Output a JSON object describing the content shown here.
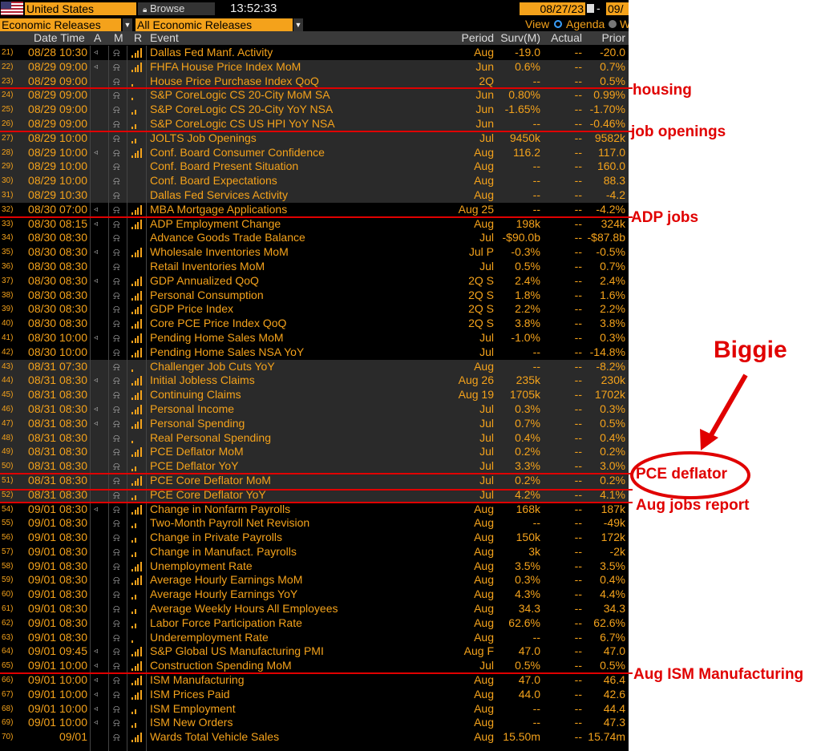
{
  "toolbar": {
    "country": "United States",
    "browse": "Browse",
    "time": "13:52:33",
    "start_date": "08/27/23",
    "end_date_partial": "09/",
    "dash": "-",
    "releases_dropdown_1": "Economic Releases",
    "releases_dropdown_2": "All Economic Releases",
    "view_label": "View",
    "view_agenda": "Agenda",
    "view_other_partial": "W"
  },
  "columns": {
    "datetime": "Date Time",
    "a": "A",
    "m": "M",
    "r": "R",
    "event": "Event",
    "period": "Period",
    "surv": "Surv(M)",
    "actual": "Actual",
    "prior": "Prior"
  },
  "rows": [
    {
      "n": "21)",
      "dt": "08/28 10:30",
      "spk": true,
      "rel": 4,
      "ev": "Dallas Fed Manf. Activity",
      "per": "Aug",
      "surv": "-19.0",
      "act": "--",
      "pri": "-20.0",
      "shade": false
    },
    {
      "n": "22)",
      "dt": "08/29 09:00",
      "spk": true,
      "rel": 4,
      "ev": "FHFA House Price Index MoM",
      "per": "Jun",
      "surv": "0.6%",
      "act": "--",
      "pri": "0.7%",
      "shade": true
    },
    {
      "n": "23)",
      "dt": "08/29 09:00",
      "spk": false,
      "rel": 1,
      "ev": "House Price Purchase Index QoQ",
      "per": "2Q",
      "surv": "--",
      "act": "--",
      "pri": "0.5%",
      "shade": true
    },
    {
      "n": "24)",
      "dt": "08/29 09:00",
      "spk": false,
      "rel": 1,
      "ev": "S&P CoreLogic CS 20-City MoM SA",
      "per": "Jun",
      "surv": "0.80%",
      "act": "--",
      "pri": "0.99%",
      "shade": true
    },
    {
      "n": "25)",
      "dt": "08/29 09:00",
      "spk": false,
      "rel": 2,
      "ev": "S&P CoreLogic CS 20-City YoY NSA",
      "per": "Jun",
      "surv": "-1.65%",
      "act": "--",
      "pri": "-1.70%",
      "shade": true
    },
    {
      "n": "26)",
      "dt": "08/29 09:00",
      "spk": false,
      "rel": 2,
      "ev": "S&P CoreLogic CS US HPI YoY NSA",
      "per": "Jun",
      "surv": "--",
      "act": "--",
      "pri": "-0.46%",
      "shade": true
    },
    {
      "n": "27)",
      "dt": "08/29 10:00",
      "spk": false,
      "rel": 2,
      "ev": "JOLTS Job Openings",
      "per": "Jul",
      "surv": "9450k",
      "act": "--",
      "pri": "9582k",
      "shade": true
    },
    {
      "n": "28)",
      "dt": "08/29 10:00",
      "spk": true,
      "rel": 4,
      "ev": "Conf. Board Consumer Confidence",
      "per": "Aug",
      "surv": "116.2",
      "act": "--",
      "pri": "117.0",
      "shade": true
    },
    {
      "n": "29)",
      "dt": "08/29 10:00",
      "spk": false,
      "rel": 0,
      "ev": "Conf. Board Present Situation",
      "per": "Aug",
      "surv": "--",
      "act": "--",
      "pri": "160.0",
      "shade": true
    },
    {
      "n": "30)",
      "dt": "08/29 10:00",
      "spk": false,
      "rel": 0,
      "ev": "Conf. Board Expectations",
      "per": "Aug",
      "surv": "--",
      "act": "--",
      "pri": "88.3",
      "shade": true
    },
    {
      "n": "31)",
      "dt": "08/29 10:30",
      "spk": false,
      "rel": 0,
      "ev": "Dallas Fed Services Activity",
      "per": "Aug",
      "surv": "--",
      "act": "--",
      "pri": "-4.2",
      "shade": true
    },
    {
      "n": "32)",
      "dt": "08/30 07:00",
      "spk": true,
      "rel": 4,
      "ev": "MBA Mortgage Applications",
      "per": "Aug 25",
      "surv": "--",
      "act": "--",
      "pri": "-4.2%",
      "shade": false
    },
    {
      "n": "33)",
      "dt": "08/30 08:15",
      "spk": true,
      "rel": 4,
      "ev": "ADP Employment Change",
      "per": "Aug",
      "surv": "198k",
      "act": "--",
      "pri": "324k",
      "shade": false
    },
    {
      "n": "34)",
      "dt": "08/30 08:30",
      "spk": false,
      "rel": 0,
      "ev": "Advance Goods Trade Balance",
      "per": "Jul",
      "surv": "-$90.0b",
      "act": "--",
      "pri": "-$87.8b",
      "shade": false
    },
    {
      "n": "35)",
      "dt": "08/30 08:30",
      "spk": true,
      "rel": 4,
      "ev": "Wholesale Inventories MoM",
      "per": "Jul P",
      "surv": "-0.3%",
      "act": "--",
      "pri": "-0.5%",
      "shade": false
    },
    {
      "n": "36)",
      "dt": "08/30 08:30",
      "spk": false,
      "rel": 0,
      "ev": "Retail Inventories MoM",
      "per": "Jul",
      "surv": "0.5%",
      "act": "--",
      "pri": "0.7%",
      "shade": false
    },
    {
      "n": "37)",
      "dt": "08/30 08:30",
      "spk": true,
      "rel": 4,
      "ev": "GDP Annualized QoQ",
      "per": "2Q S",
      "surv": "2.4%",
      "act": "--",
      "pri": "2.4%",
      "shade": false
    },
    {
      "n": "38)",
      "dt": "08/30 08:30",
      "spk": false,
      "rel": 4,
      "ev": "Personal Consumption",
      "per": "2Q S",
      "surv": "1.8%",
      "act": "--",
      "pri": "1.6%",
      "shade": false
    },
    {
      "n": "39)",
      "dt": "08/30 08:30",
      "spk": false,
      "rel": 4,
      "ev": "GDP Price Index",
      "per": "2Q S",
      "surv": "2.2%",
      "act": "--",
      "pri": "2.2%",
      "shade": false
    },
    {
      "n": "40)",
      "dt": "08/30 08:30",
      "spk": false,
      "rel": 4,
      "ev": "Core PCE Price Index QoQ",
      "per": "2Q S",
      "surv": "3.8%",
      "act": "--",
      "pri": "3.8%",
      "shade": false
    },
    {
      "n": "41)",
      "dt": "08/30 10:00",
      "spk": true,
      "rel": 4,
      "ev": "Pending Home Sales MoM",
      "per": "Jul",
      "surv": "-1.0%",
      "act": "--",
      "pri": "0.3%",
      "shade": false
    },
    {
      "n": "42)",
      "dt": "08/30 10:00",
      "spk": false,
      "rel": 4,
      "ev": "Pending Home Sales NSA YoY",
      "per": "Jul",
      "surv": "--",
      "act": "--",
      "pri": "-14.8%",
      "shade": false
    },
    {
      "n": "43)",
      "dt": "08/31 07:30",
      "spk": false,
      "rel": 1,
      "ev": "Challenger Job Cuts YoY",
      "per": "Aug",
      "surv": "--",
      "act": "--",
      "pri": "-8.2%",
      "shade": true
    },
    {
      "n": "44)",
      "dt": "08/31 08:30",
      "spk": true,
      "rel": 4,
      "ev": "Initial Jobless Claims",
      "per": "Aug 26",
      "surv": "235k",
      "act": "--",
      "pri": "230k",
      "shade": true
    },
    {
      "n": "45)",
      "dt": "08/31 08:30",
      "spk": false,
      "rel": 4,
      "ev": "Continuing Claims",
      "per": "Aug 19",
      "surv": "1705k",
      "act": "--",
      "pri": "1702k",
      "shade": true
    },
    {
      "n": "46)",
      "dt": "08/31 08:30",
      "spk": true,
      "rel": 4,
      "ev": "Personal Income",
      "per": "Jul",
      "surv": "0.3%",
      "act": "--",
      "pri": "0.3%",
      "shade": true
    },
    {
      "n": "47)",
      "dt": "08/31 08:30",
      "spk": true,
      "rel": 4,
      "ev": "Personal Spending",
      "per": "Jul",
      "surv": "0.7%",
      "act": "--",
      "pri": "0.5%",
      "shade": true
    },
    {
      "n": "48)",
      "dt": "08/31 08:30",
      "spk": false,
      "rel": 1,
      "ev": "Real Personal Spending",
      "per": "Jul",
      "surv": "0.4%",
      "act": "--",
      "pri": "0.4%",
      "shade": true
    },
    {
      "n": "49)",
      "dt": "08/31 08:30",
      "spk": false,
      "rel": 4,
      "ev": "PCE Deflator MoM",
      "per": "Jul",
      "surv": "0.2%",
      "act": "--",
      "pri": "0.2%",
      "shade": true
    },
    {
      "n": "50)",
      "dt": "08/31 08:30",
      "spk": false,
      "rel": 2,
      "ev": "PCE Deflator YoY",
      "per": "Jul",
      "surv": "3.3%",
      "act": "--",
      "pri": "3.0%",
      "shade": true
    },
    {
      "n": "51)",
      "dt": "08/31 08:30",
      "spk": false,
      "rel": 4,
      "ev": "PCE Core Deflator MoM",
      "per": "Jul",
      "surv": "0.2%",
      "act": "--",
      "pri": "0.2%",
      "shade": true
    },
    {
      "n": "52)",
      "dt": "08/31 08:30",
      "spk": false,
      "rel": 2,
      "ev": "PCE Core Deflator YoY",
      "per": "Jul",
      "surv": "4.2%",
      "act": "--",
      "pri": "4.1%",
      "shade": true
    },
    {
      "n": "54)",
      "dt": "09/01 08:30",
      "spk": true,
      "rel": 4,
      "ev": "Change in Nonfarm Payrolls",
      "per": "Aug",
      "surv": "168k",
      "act": "--",
      "pri": "187k",
      "shade": false
    },
    {
      "n": "55)",
      "dt": "09/01 08:30",
      "spk": false,
      "rel": 2,
      "ev": "Two-Month Payroll Net Revision",
      "per": "Aug",
      "surv": "--",
      "act": "--",
      "pri": "-49k",
      "shade": false
    },
    {
      "n": "56)",
      "dt": "09/01 08:30",
      "spk": false,
      "rel": 2,
      "ev": "Change in Private Payrolls",
      "per": "Aug",
      "surv": "150k",
      "act": "--",
      "pri": "172k",
      "shade": false
    },
    {
      "n": "57)",
      "dt": "09/01 08:30",
      "spk": false,
      "rel": 2,
      "ev": "Change in Manufact. Payrolls",
      "per": "Aug",
      "surv": "3k",
      "act": "--",
      "pri": "-2k",
      "shade": false
    },
    {
      "n": "58)",
      "dt": "09/01 08:30",
      "spk": false,
      "rel": 4,
      "ev": "Unemployment Rate",
      "per": "Aug",
      "surv": "3.5%",
      "act": "--",
      "pri": "3.5%",
      "shade": false
    },
    {
      "n": "59)",
      "dt": "09/01 08:30",
      "spk": false,
      "rel": 4,
      "ev": "Average Hourly Earnings MoM",
      "per": "Aug",
      "surv": "0.3%",
      "act": "--",
      "pri": "0.4%",
      "shade": false
    },
    {
      "n": "60)",
      "dt": "09/01 08:30",
      "spk": false,
      "rel": 2,
      "ev": "Average Hourly Earnings YoY",
      "per": "Aug",
      "surv": "4.3%",
      "act": "--",
      "pri": "4.4%",
      "shade": false
    },
    {
      "n": "61)",
      "dt": "09/01 08:30",
      "spk": false,
      "rel": 2,
      "ev": "Average Weekly Hours All Employees",
      "per": "Aug",
      "surv": "34.3",
      "act": "--",
      "pri": "34.3",
      "shade": false
    },
    {
      "n": "62)",
      "dt": "09/01 08:30",
      "spk": false,
      "rel": 2,
      "ev": "Labor Force Participation Rate",
      "per": "Aug",
      "surv": "62.6%",
      "act": "--",
      "pri": "62.6%",
      "shade": false
    },
    {
      "n": "63)",
      "dt": "09/01 08:30",
      "spk": false,
      "rel": 1,
      "ev": "Underemployment Rate",
      "per": "Aug",
      "surv": "--",
      "act": "--",
      "pri": "6.7%",
      "shade": false
    },
    {
      "n": "64)",
      "dt": "09/01 09:45",
      "spk": true,
      "rel": 4,
      "ev": "S&P Global US Manufacturing PMI",
      "per": "Aug F",
      "surv": "47.0",
      "act": "--",
      "pri": "47.0",
      "shade": false
    },
    {
      "n": "65)",
      "dt": "09/01 10:00",
      "spk": true,
      "rel": 4,
      "ev": "Construction Spending MoM",
      "per": "Jul",
      "surv": "0.5%",
      "act": "--",
      "pri": "0.5%",
      "shade": false
    },
    {
      "n": "66)",
      "dt": "09/01 10:00",
      "spk": true,
      "rel": 4,
      "ev": "ISM Manufacturing",
      "per": "Aug",
      "surv": "47.0",
      "act": "--",
      "pri": "46.4",
      "shade": false
    },
    {
      "n": "67)",
      "dt": "09/01 10:00",
      "spk": true,
      "rel": 4,
      "ev": "ISM Prices Paid",
      "per": "Aug",
      "surv": "44.0",
      "act": "--",
      "pri": "42.6",
      "shade": false
    },
    {
      "n": "68)",
      "dt": "09/01 10:00",
      "spk": true,
      "rel": 2,
      "ev": "ISM Employment",
      "per": "Aug",
      "surv": "--",
      "act": "--",
      "pri": "44.4",
      "shade": false
    },
    {
      "n": "69)",
      "dt": "09/01 10:00",
      "spk": true,
      "rel": 2,
      "ev": "ISM New Orders",
      "per": "Aug",
      "surv": "--",
      "act": "--",
      "pri": "47.3",
      "shade": false
    },
    {
      "n": "70)",
      "dt": "09/01",
      "spk": false,
      "rel": 4,
      "ev": "Wards Total Vehicle Sales",
      "per": "Aug",
      "surv": "15.50m",
      "act": "--",
      "pri": "15.74m",
      "shade": false
    }
  ],
  "annotations": {
    "housing": "housing",
    "job_openings": "job openings",
    "adp": "ADP jobs",
    "biggie": "Biggie",
    "pce": "PCE deflator",
    "aug_jobs": "Aug jobs report",
    "ism": "Aug ISM Manufacturing"
  },
  "colors": {
    "accent": "#f4a21b",
    "annotation": "#e00000",
    "background": "#000000",
    "shaded_row": "#2a2a2a"
  },
  "icons": {
    "flag": "us-flag-icon",
    "browse": "lock-icon",
    "calendar": "calendar-icon",
    "alert": "speaker-icon",
    "monitor": "bell-icon",
    "relevance": "signal-bars-icon"
  }
}
